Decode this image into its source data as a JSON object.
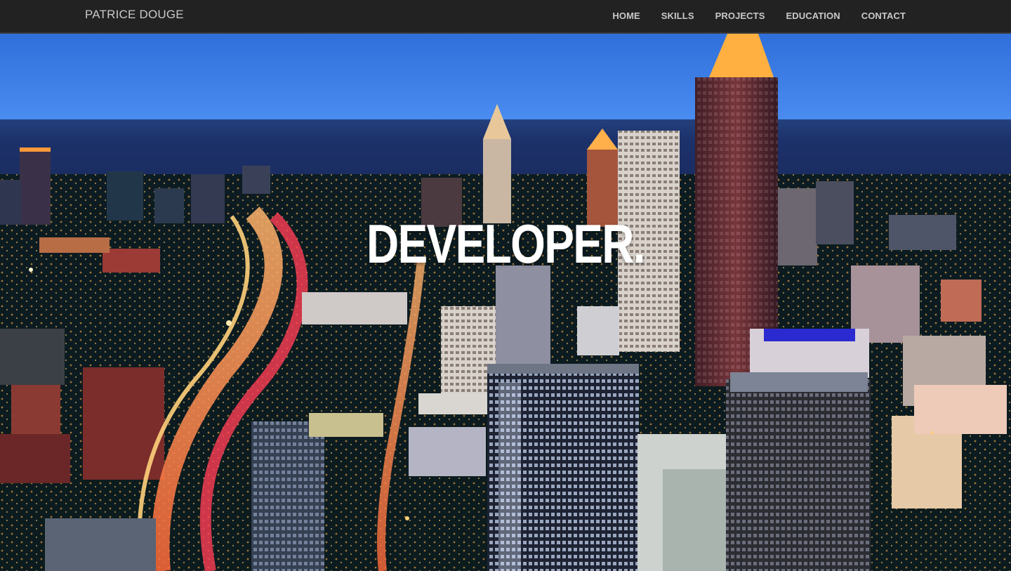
{
  "navbar": {
    "brand": "PATRICE DOUGE",
    "links": [
      {
        "label": "HOME"
      },
      {
        "label": "SKILLS"
      },
      {
        "label": "PROJECTS"
      },
      {
        "label": "EDUCATION"
      },
      {
        "label": "CONTACT"
      }
    ]
  },
  "hero": {
    "title": "DEVELOPER",
    "title_suffix": ".",
    "background_image": "city-skyline-at-dusk"
  },
  "colors": {
    "navbar_bg": "#222222",
    "nav_text": "#c9c9c9",
    "hero_text": "#ffffff",
    "sky_top": "#2d6fd6"
  }
}
